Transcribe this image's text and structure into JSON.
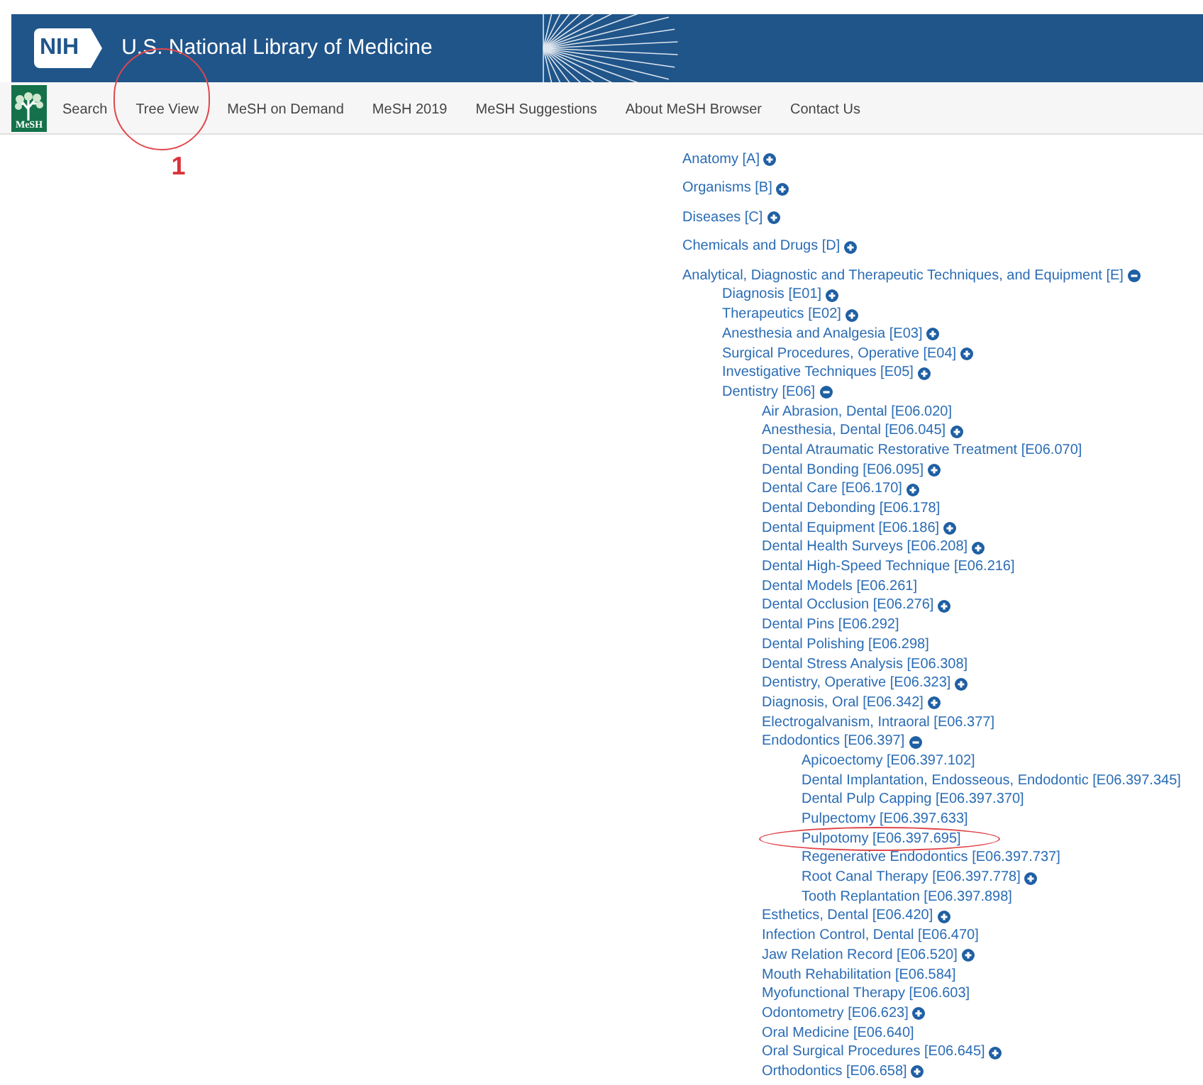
{
  "header": {
    "logo_text": "NIH",
    "title": "U.S. National Library of Medicine"
  },
  "nav": {
    "logo_text": "MeSH",
    "items": [
      {
        "label": "Search",
        "circled": false
      },
      {
        "label": "Tree View",
        "circled": true,
        "callout": "1"
      },
      {
        "label": "MeSH on Demand",
        "circled": false
      },
      {
        "label": "MeSH 2019",
        "circled": false
      },
      {
        "label": "MeSH Suggestions",
        "circled": false
      },
      {
        "label": "About MeSH Browser",
        "circled": false
      },
      {
        "label": "Contact Us",
        "circled": false
      }
    ]
  },
  "tree": [
    {
      "label": "Anatomy [A]",
      "kind": "collapsed"
    },
    {
      "label": "Organisms [B]",
      "kind": "collapsed"
    },
    {
      "label": "Diseases [C]",
      "kind": "collapsed"
    },
    {
      "label": "Chemicals and Drugs [D]",
      "kind": "collapsed"
    },
    {
      "label": "Analytical, Diagnostic and Therapeutic Techniques, and Equipment [E]",
      "kind": "expanded",
      "children": [
        {
          "label": "Diagnosis [E01]",
          "kind": "collapsed"
        },
        {
          "label": "Therapeutics [E02]",
          "kind": "collapsed"
        },
        {
          "label": "Anesthesia and Analgesia [E03]",
          "kind": "collapsed"
        },
        {
          "label": "Surgical Procedures, Operative [E04]",
          "kind": "collapsed"
        },
        {
          "label": "Investigative Techniques [E05]",
          "kind": "collapsed"
        },
        {
          "label": "Dentistry [E06]",
          "kind": "expanded",
          "children": [
            {
              "label": "Air Abrasion, Dental [E06.020]",
              "kind": "leaf"
            },
            {
              "label": "Anesthesia, Dental [E06.045]",
              "kind": "collapsed"
            },
            {
              "label": "Dental Atraumatic Restorative Treatment [E06.070]",
              "kind": "leaf"
            },
            {
              "label": "Dental Bonding [E06.095]",
              "kind": "collapsed"
            },
            {
              "label": "Dental Care [E06.170]",
              "kind": "collapsed"
            },
            {
              "label": "Dental Debonding [E06.178]",
              "kind": "leaf"
            },
            {
              "label": "Dental Equipment [E06.186]",
              "kind": "collapsed"
            },
            {
              "label": "Dental Health Surveys [E06.208]",
              "kind": "collapsed"
            },
            {
              "label": "Dental High-Speed Technique [E06.216]",
              "kind": "leaf"
            },
            {
              "label": "Dental Models [E06.261]",
              "kind": "leaf"
            },
            {
              "label": "Dental Occlusion [E06.276]",
              "kind": "collapsed"
            },
            {
              "label": "Dental Pins [E06.292]",
              "kind": "leaf"
            },
            {
              "label": "Dental Polishing [E06.298]",
              "kind": "leaf"
            },
            {
              "label": "Dental Stress Analysis [E06.308]",
              "kind": "leaf"
            },
            {
              "label": "Dentistry, Operative [E06.323]",
              "kind": "collapsed"
            },
            {
              "label": "Diagnosis, Oral [E06.342]",
              "kind": "collapsed"
            },
            {
              "label": "Electrogalvanism, Intraoral [E06.377]",
              "kind": "leaf"
            },
            {
              "label": "Endodontics [E06.397]",
              "kind": "expanded",
              "children": [
                {
                  "label": "Apicoectomy [E06.397.102]",
                  "kind": "leaf",
                  "circled": false
                },
                {
                  "label": "Dental Implantation, Endosseous, Endodontic [E06.397.345]",
                  "kind": "leaf",
                  "circled": false
                },
                {
                  "label": "Dental Pulp Capping [E06.397.370]",
                  "kind": "leaf",
                  "circled": false
                },
                {
                  "label": "Pulpectomy [E06.397.633]",
                  "kind": "leaf",
                  "circled": false
                },
                {
                  "label": "Pulpotomy [E06.397.695]",
                  "kind": "leaf",
                  "circled": true
                },
                {
                  "label": "Regenerative Endodontics [E06.397.737]",
                  "kind": "leaf",
                  "circled": false
                },
                {
                  "label": "Root Canal Therapy [E06.397.778]",
                  "kind": "collapsed",
                  "circled": false
                },
                {
                  "label": "Tooth Replantation [E06.397.898]",
                  "kind": "leaf",
                  "circled": false
                }
              ]
            },
            {
              "label": "Esthetics, Dental [E06.420]",
              "kind": "collapsed"
            },
            {
              "label": "Infection Control, Dental [E06.470]",
              "kind": "leaf"
            },
            {
              "label": "Jaw Relation Record [E06.520]",
              "kind": "collapsed"
            },
            {
              "label": "Mouth Rehabilitation [E06.584]",
              "kind": "leaf"
            },
            {
              "label": "Myofunctional Therapy [E06.603]",
              "kind": "leaf"
            },
            {
              "label": "Odontometry [E06.623]",
              "kind": "collapsed"
            },
            {
              "label": "Oral Medicine [E06.640]",
              "kind": "leaf"
            },
            {
              "label": "Oral Surgical Procedures [E06.645]",
              "kind": "collapsed"
            },
            {
              "label": "Orthodontics [E06.658]",
              "kind": "collapsed"
            }
          ]
        }
      ]
    }
  ]
}
